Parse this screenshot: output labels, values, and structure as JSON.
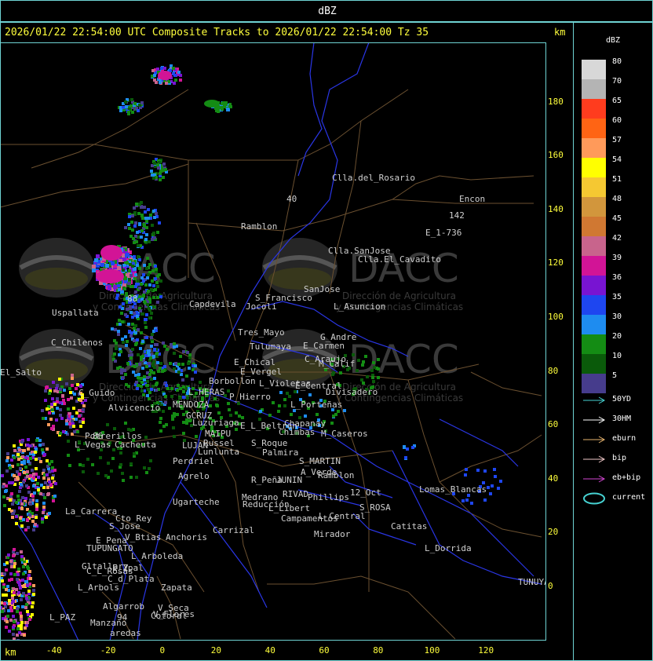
{
  "top_title": "dBZ",
  "header": "2026/01/22 22:54:00 UTC Composite Tracks to 2026/01/22 22:54:00 Tz 35",
  "km_label": "km",
  "y_axis": [
    {
      "value": "180",
      "km": 180
    },
    {
      "value": "160",
      "km": 160
    },
    {
      "value": "140",
      "km": 140
    },
    {
      "value": "120",
      "km": 120
    },
    {
      "value": "100",
      "km": 100
    },
    {
      "value": "80",
      "km": 80
    },
    {
      "value": "60",
      "km": 60
    },
    {
      "value": "40",
      "km": 40
    },
    {
      "value": "20",
      "km": 20
    },
    {
      "value": "0",
      "km": 0
    }
  ],
  "x_axis": [
    {
      "value": "-40",
      "km": -40
    },
    {
      "value": "-20",
      "km": -20
    },
    {
      "value": "0",
      "km": 0
    },
    {
      "value": "20",
      "km": 20
    },
    {
      "value": "40",
      "km": 40
    },
    {
      "value": "60",
      "km": 60
    },
    {
      "value": "80",
      "km": 80
    },
    {
      "value": "100",
      "km": 100
    },
    {
      "value": "120",
      "km": 120
    }
  ],
  "legend": {
    "title": "dBZ",
    "levels": [
      {
        "label": "80",
        "color": "#d8d8d8"
      },
      {
        "label": "70",
        "color": "#b4b4b4"
      },
      {
        "label": "65",
        "color": "#ff3c1e"
      },
      {
        "label": "60",
        "color": "#ff6414"
      },
      {
        "label": "57",
        "color": "#ff9a5a"
      },
      {
        "label": "54",
        "color": "#ffff00"
      },
      {
        "label": "51",
        "color": "#f5c832"
      },
      {
        "label": "48",
        "color": "#d2963c"
      },
      {
        "label": "45",
        "color": "#d07832"
      },
      {
        "label": "42",
        "color": "#c8648c"
      },
      {
        "label": "39",
        "color": "#d21496"
      },
      {
        "label": "36",
        "color": "#7814d2"
      },
      {
        "label": "35",
        "color": "#1e46f0"
      },
      {
        "label": "30",
        "color": "#1e8cf0"
      },
      {
        "label": "20",
        "color": "#148c14"
      },
      {
        "label": "10",
        "color": "#0a5a0a"
      },
      {
        "label": "5",
        "color": "#463c8c"
      }
    ],
    "tracks": [
      {
        "label": "50YD",
        "color": "#46d2d2"
      },
      {
        "label": "30HM",
        "color": "#ffffff"
      },
      {
        "label": "eburn",
        "color": "#e6b46e"
      },
      {
        "label": "bip",
        "color": "#f0c8c8"
      },
      {
        "label": "eb+bip",
        "color": "#d246d2"
      },
      {
        "label": "current",
        "color": "#46d2d2"
      }
    ]
  },
  "watermark": {
    "name": "DACC",
    "line1": "Dirección de Agricultura",
    "line2": "y Contingencias Climáticas"
  },
  "places": [
    {
      "name": "Clla.del_Rosario"
    },
    {
      "name": "Encon"
    },
    {
      "name": "142"
    },
    {
      "name": "E_1-736"
    },
    {
      "name": "Ramblon"
    },
    {
      "name": "40"
    },
    {
      "name": "Clla.SanJose"
    },
    {
      "name": "Clla.El_Cavadito"
    },
    {
      "name": "Uspallata"
    },
    {
      "name": "Capdevila"
    },
    {
      "name": "S_Francisco"
    },
    {
      "name": "Jocoli"
    },
    {
      "name": "SanJose"
    },
    {
      "name": "L_Asuncion"
    },
    {
      "name": "Tres_Mayo"
    },
    {
      "name": "G_Andre"
    },
    {
      "name": "E_Carmen"
    },
    {
      "name": "C_Chilenos"
    },
    {
      "name": "Tulumaya"
    },
    {
      "name": "E_Chical"
    },
    {
      "name": "C_Araujo"
    },
    {
      "name": "M_Calif"
    },
    {
      "name": "E_Vergel"
    },
    {
      "name": "Borbollon"
    },
    {
      "name": "L_Violetas"
    },
    {
      "name": "E_Central"
    },
    {
      "name": "Divisadero"
    },
    {
      "name": "L_HERAS"
    },
    {
      "name": "P_Hierro"
    },
    {
      "name": "C_Guido"
    },
    {
      "name": "Potrerillos"
    },
    {
      "name": "MENDOZA"
    },
    {
      "name": "L_Porteñas"
    },
    {
      "name": "GCRUZ"
    },
    {
      "name": "Luzuriaga"
    },
    {
      "name": "Chapanay"
    },
    {
      "name": "E_L_Beltran"
    },
    {
      "name": "Chimbas"
    },
    {
      "name": "M_Caseros"
    },
    {
      "name": "MAIPU"
    },
    {
      "name": "Russel"
    },
    {
      "name": "L_Vegas"
    },
    {
      "name": "Cacheuta"
    },
    {
      "name": "LUJAN"
    },
    {
      "name": "Lunlunta"
    },
    {
      "name": "S_Roque"
    },
    {
      "name": "Palmira"
    },
    {
      "name": "Perdriel"
    },
    {
      "name": "S_MARTIN"
    },
    {
      "name": "A_Verde"
    },
    {
      "name": "Agrelo"
    },
    {
      "name": "R_Peña"
    },
    {
      "name": "JUNIN"
    },
    {
      "name": "Ramblon"
    },
    {
      "name": "Ugarteche"
    },
    {
      "name": "Medrano"
    },
    {
      "name": "Reducción"
    },
    {
      "name": "RIVAD"
    },
    {
      "name": "Phillips"
    },
    {
      "name": "12_Oct"
    },
    {
      "name": "Lomas_Blancas"
    },
    {
      "name": "L_Libert"
    },
    {
      "name": "S_ROSA"
    },
    {
      "name": "La_Carrera"
    },
    {
      "name": "Cto_Rey"
    },
    {
      "name": "S_Jose"
    },
    {
      "name": "Carrizal"
    },
    {
      "name": "Campamentos"
    },
    {
      "name": "L_Central"
    },
    {
      "name": "Catitas"
    },
    {
      "name": "V_Btias"
    },
    {
      "name": "E_Pena"
    },
    {
      "name": "Anchoris"
    },
    {
      "name": "Mirador"
    },
    {
      "name": "TUPUNGATO"
    },
    {
      "name": "L_Dorrida"
    },
    {
      "name": "L_Arboleda"
    },
    {
      "name": "Gltallary"
    },
    {
      "name": "E_Zpal"
    },
    {
      "name": "C_d_Plata"
    },
    {
      "name": "L_Arbols"
    },
    {
      "name": "Zapata"
    },
    {
      "name": "Algarrob"
    },
    {
      "name": "V_Seca"
    },
    {
      "name": "Cotoral"
    },
    {
      "name": "L_PAZ"
    },
    {
      "name": "Manzano"
    },
    {
      "name": "94"
    },
    {
      "name": "TUNUYAN"
    },
    {
      "name": "C_L_Rosas"
    },
    {
      "name": "V_Flores"
    },
    {
      "name": "aredas"
    },
    {
      "name": "El_Salto"
    },
    {
      "name": "Alvicencio"
    },
    {
      "name": "88"
    },
    {
      "name": "86"
    }
  ]
}
